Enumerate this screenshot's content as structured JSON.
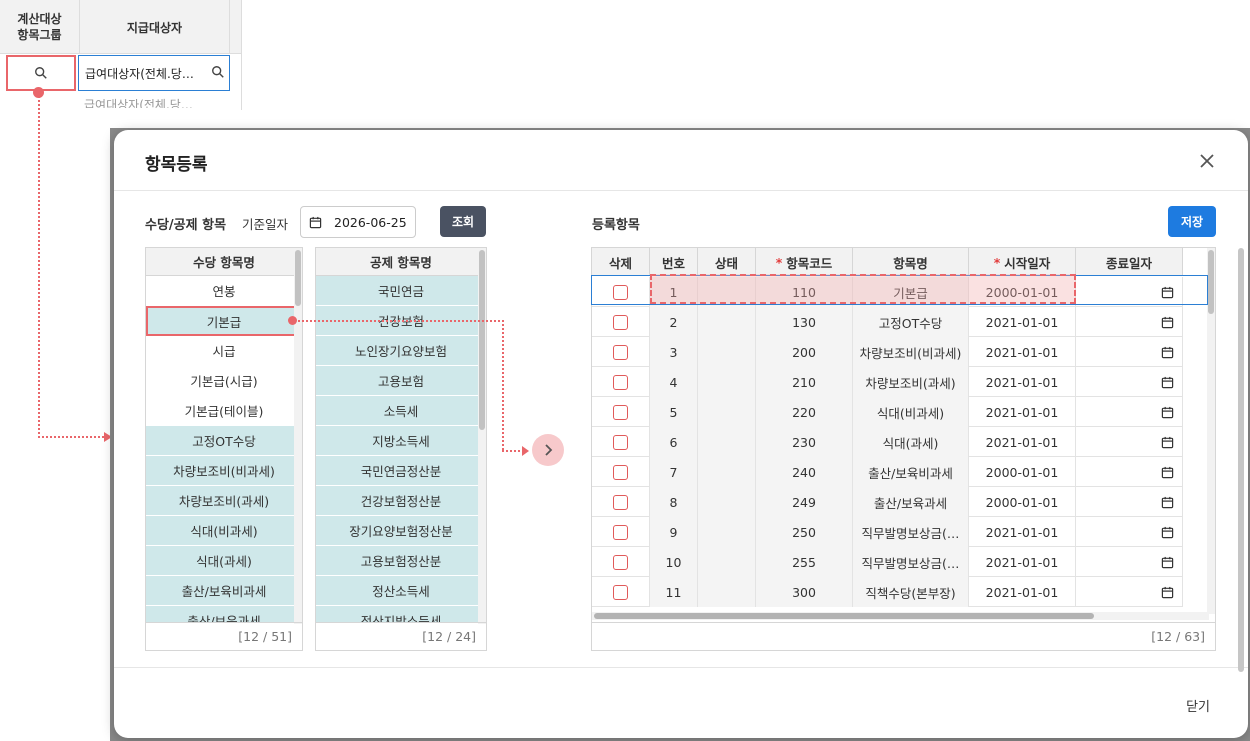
{
  "background_grid": {
    "col1_header": "계산대상\n항목그룹",
    "col2_header": "지급대상자",
    "row1_target": "급여대상자(전체.당…",
    "row2_target": "급여대상자(전체.당…"
  },
  "modal": {
    "title": "항목등록",
    "close_label": "닫기",
    "left_section_title": "수당/공제 항목",
    "base_date_label": "기준일자",
    "base_date_value": "2026-06-25",
    "query_button": "조회",
    "right_section_title": "등록항목",
    "save_button": "저장"
  },
  "allowance_list": {
    "header": "수당 항목명",
    "items": [
      {
        "label": "연봉",
        "style": "plain"
      },
      {
        "label": "기본급",
        "style": "sel"
      },
      {
        "label": "시급",
        "style": "plain"
      },
      {
        "label": "기본급(시급)",
        "style": "plain"
      },
      {
        "label": "기본급(테이블)",
        "style": "plain"
      },
      {
        "label": "고정OT수당",
        "style": "teal"
      },
      {
        "label": "차량보조비(비과세)",
        "style": "teal"
      },
      {
        "label": "차량보조비(과세)",
        "style": "teal"
      },
      {
        "label": "식대(비과세)",
        "style": "teal"
      },
      {
        "label": "식대(과세)",
        "style": "teal"
      },
      {
        "label": "출산/보육비과세",
        "style": "teal"
      },
      {
        "label": "출산/보육과세",
        "style": "teal"
      }
    ],
    "footer": "[12 / 51]"
  },
  "deduction_list": {
    "header": "공제 항목명",
    "items": [
      {
        "label": "국민연금",
        "style": "teal"
      },
      {
        "label": "건강보험",
        "style": "teal"
      },
      {
        "label": "노인장기요양보험",
        "style": "teal"
      },
      {
        "label": "고용보험",
        "style": "teal"
      },
      {
        "label": "소득세",
        "style": "teal"
      },
      {
        "label": "지방소득세",
        "style": "teal"
      },
      {
        "label": "국민연금정산분",
        "style": "teal"
      },
      {
        "label": "건강보험정산분",
        "style": "teal"
      },
      {
        "label": "장기요양보험정산분",
        "style": "teal"
      },
      {
        "label": "고용보험정산분",
        "style": "teal"
      },
      {
        "label": "정산소득세",
        "style": "teal"
      },
      {
        "label": "정산지방소득세",
        "style": "teal"
      }
    ],
    "footer": "[12 / 24]"
  },
  "registered_table": {
    "columns": [
      "삭제",
      "번호",
      "상태",
      "항목코드",
      "항목명",
      "시작일자",
      "종료일자"
    ],
    "required_columns": [
      "항목코드",
      "시작일자"
    ],
    "rows": [
      {
        "no": "1",
        "code": "110",
        "name": "기본급",
        "start": "2000-01-01"
      },
      {
        "no": "2",
        "code": "130",
        "name": "고정OT수당",
        "start": "2021-01-01"
      },
      {
        "no": "3",
        "code": "200",
        "name": "차량보조비(비과세)",
        "start": "2021-01-01"
      },
      {
        "no": "4",
        "code": "210",
        "name": "차량보조비(과세)",
        "start": "2021-01-01"
      },
      {
        "no": "5",
        "code": "220",
        "name": "식대(비과세)",
        "start": "2021-01-01"
      },
      {
        "no": "6",
        "code": "230",
        "name": "식대(과세)",
        "start": "2021-01-01"
      },
      {
        "no": "7",
        "code": "240",
        "name": "출산/보육비과세",
        "start": "2000-01-01"
      },
      {
        "no": "8",
        "code": "249",
        "name": "출산/보육과세",
        "start": "2000-01-01"
      },
      {
        "no": "9",
        "code": "250",
        "name": "직무발명보상금(…",
        "start": "2021-01-01"
      },
      {
        "no": "10",
        "code": "255",
        "name": "직무발명보상금(…",
        "start": "2021-01-01"
      },
      {
        "no": "11",
        "code": "300",
        "name": "직책수당(본부장)",
        "start": "2021-01-01"
      }
    ],
    "footer": "[12 / 63]"
  },
  "colors": {
    "highlight_red": "#e9666a",
    "teal_row": "#cfe8ea",
    "primary_blue": "#1e7be0",
    "query_dark": "#4a5262"
  },
  "icons": [
    "search-icon",
    "close-icon",
    "calendar-icon",
    "chevron-right-icon"
  ]
}
